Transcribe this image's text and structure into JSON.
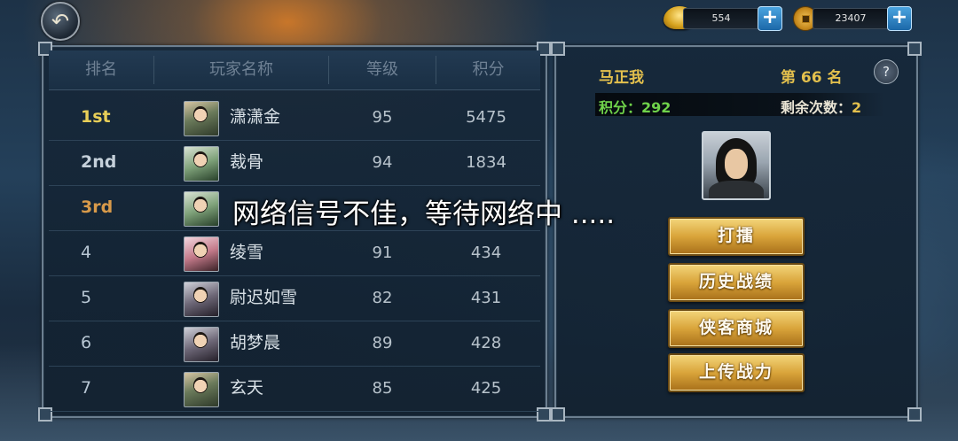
{
  "currencies": [
    {
      "icon": "gold-ingot-icon",
      "value": "554"
    },
    {
      "icon": "copper-coin-icon",
      "value": "23407"
    }
  ],
  "leaderboard": {
    "headers": {
      "rank": "排名",
      "name": "玩家名称",
      "level": "等级",
      "score": "积分"
    },
    "rows": [
      {
        "rank": "1st",
        "name": "潇潇金",
        "level": "95",
        "score": "5475"
      },
      {
        "rank": "2nd",
        "name": "裁骨",
        "level": "94",
        "score": "1834"
      },
      {
        "rank": "3rd",
        "name": "",
        "level": "",
        "score": ""
      },
      {
        "rank": "4",
        "name": "绫雪",
        "level": "91",
        "score": "434"
      },
      {
        "rank": "5",
        "name": "尉迟如雪",
        "level": "82",
        "score": "431"
      },
      {
        "rank": "6",
        "name": "胡梦晨",
        "level": "89",
        "score": "428"
      },
      {
        "rank": "7",
        "name": "玄天",
        "level": "85",
        "score": "425"
      }
    ]
  },
  "player": {
    "name": "马正我",
    "rank_label": "第 66 名",
    "points_label": "积分：",
    "points": "292",
    "remaining_label": "剩余次数：",
    "remaining": "2",
    "help": "?"
  },
  "actions": {
    "challenge": "打擂",
    "history": "历史战绩",
    "shop": "侠客商城",
    "upload": "上传战力"
  },
  "toast": "网络信号不佳，等待网络中 ....."
}
